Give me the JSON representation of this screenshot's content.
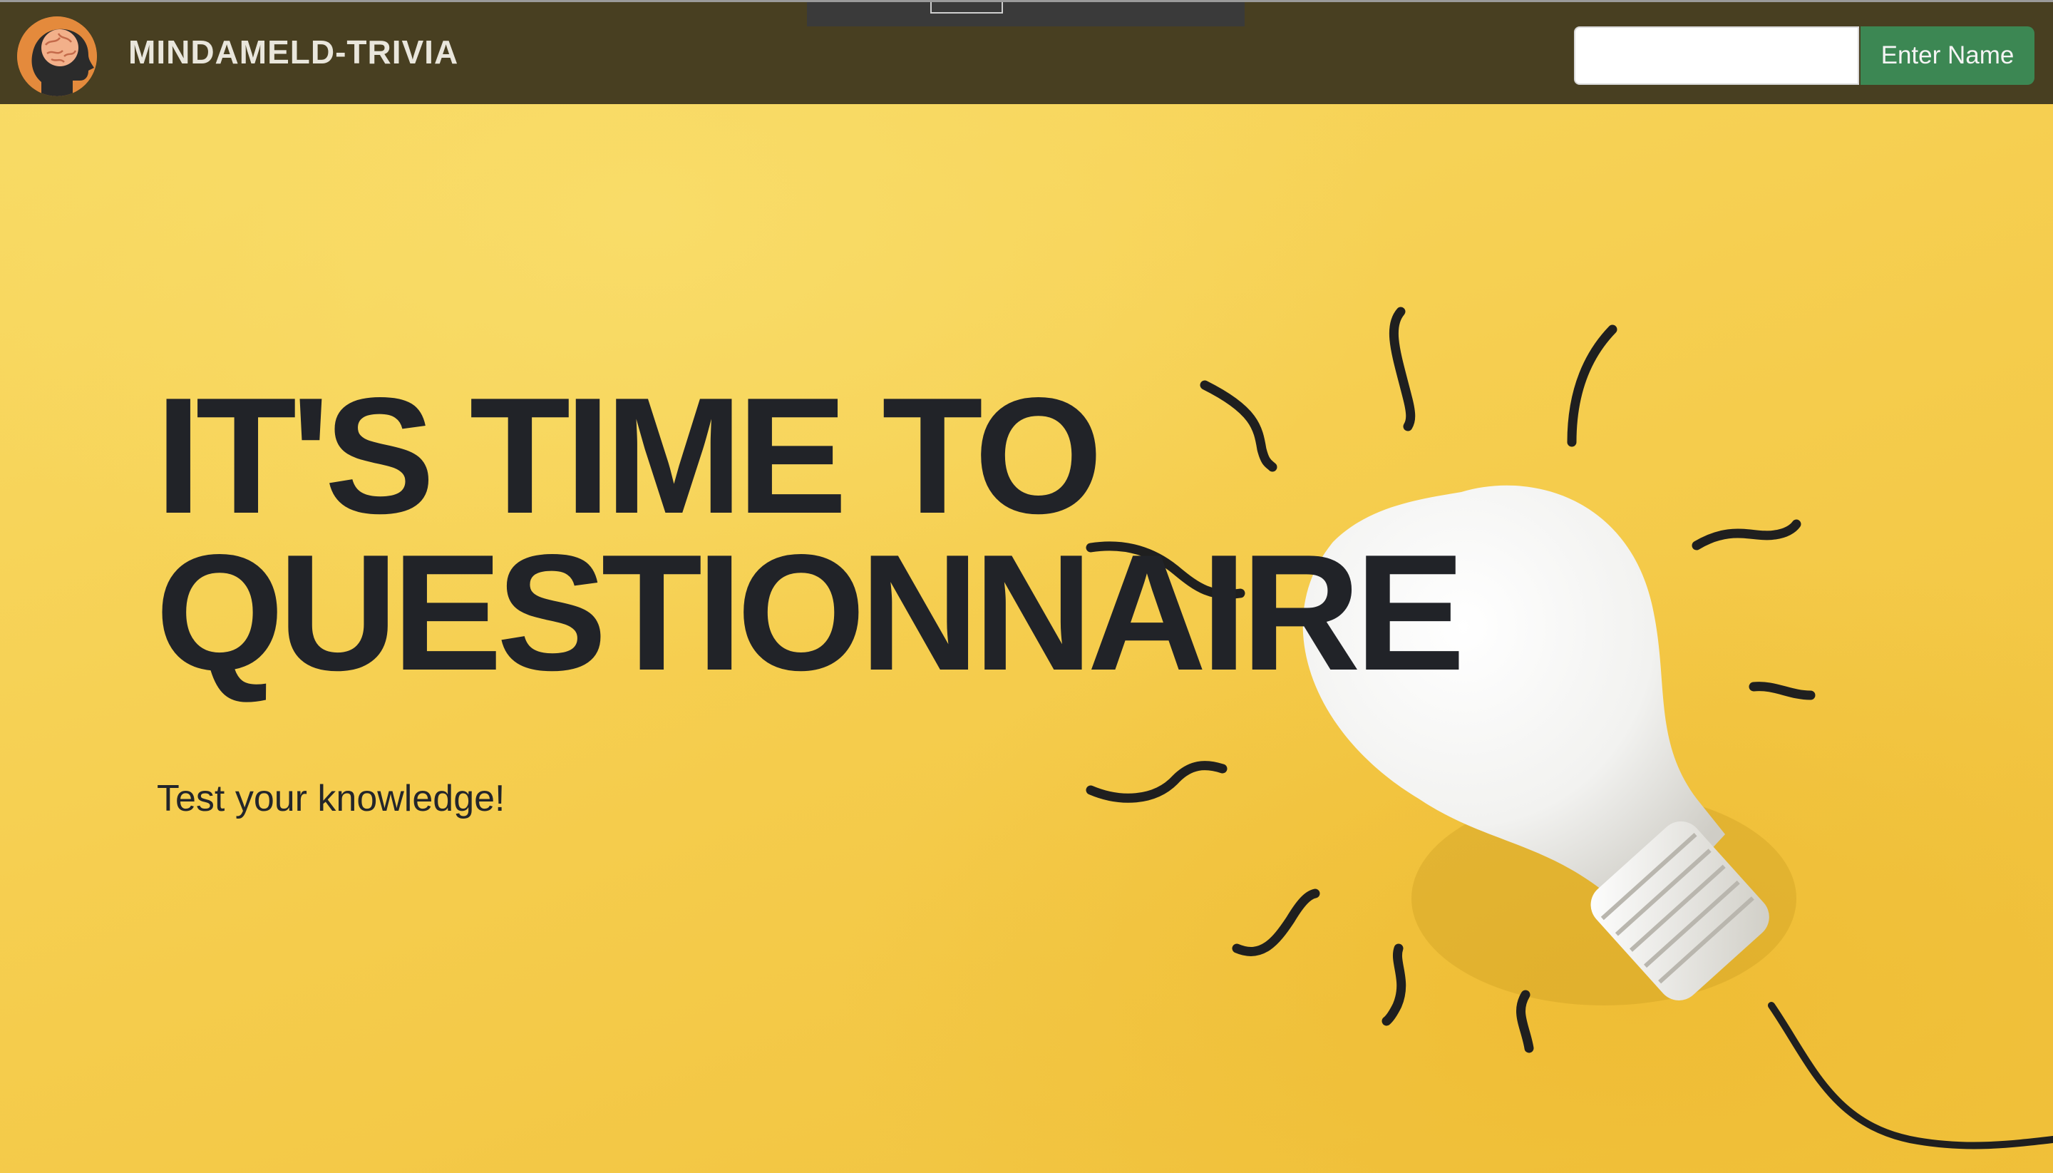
{
  "navbar": {
    "brand": "MINDAMELD-TRIVIA",
    "logo_icon": "brain-head-icon",
    "name_input_value": "",
    "name_input_placeholder": "",
    "name_button_label": "Enter Name",
    "button_color": "#3c8753",
    "background_color": "#483f21"
  },
  "hero": {
    "headline_line1": "IT'S TIME TO",
    "headline_line2": "QUESTIONNAIRE",
    "subtitle": "Test your knowledge!",
    "background_icon": "lightbulb-icon",
    "accent_color": "#f6cf4f"
  }
}
